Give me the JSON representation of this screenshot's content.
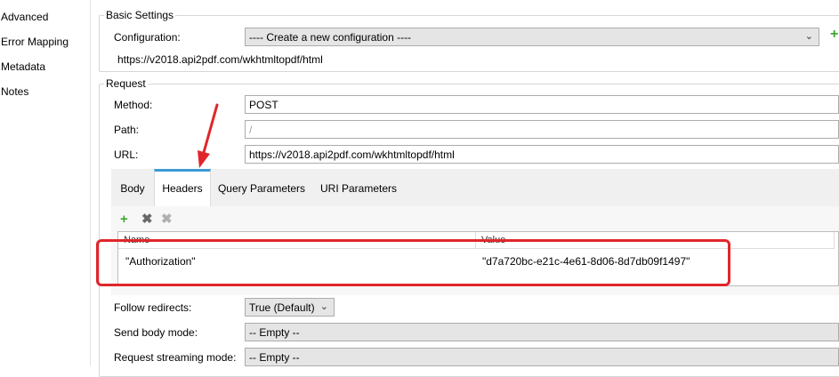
{
  "nav": {
    "items": [
      "Advanced",
      "Error Mapping",
      "Metadata",
      "Notes"
    ]
  },
  "basic_settings": {
    "title": "Basic Settings",
    "configuration_label": "Configuration:",
    "configuration_value": "---- Create a new configuration ----",
    "url_preview": "https://v2018.api2pdf.com/wkhtmltopdf/html"
  },
  "request": {
    "title": "Request",
    "method_label": "Method:",
    "method_value": "POST",
    "path_label": "Path:",
    "path_value": "/",
    "url_label": "URL:",
    "url_value": "https://v2018.api2pdf.com/wkhtmltopdf/html",
    "tabs": [
      "Body",
      "Headers",
      "Query Parameters",
      "URI Parameters"
    ],
    "active_tab": "Headers",
    "headers_table": {
      "columns": [
        "Name",
        "Value"
      ],
      "rows": [
        {
          "name": "\"Authorization\"",
          "value": "\"d7a720bc-e21c-4e61-8d06-8d7db09f1497\""
        }
      ]
    },
    "follow_redirects_label": "Follow redirects:",
    "follow_redirects_value": "True (Default)",
    "send_body_mode_label": "Send body mode:",
    "send_body_mode_value": "-- Empty --",
    "request_streaming_mode_label": "Request streaming mode:",
    "request_streaming_mode_value": "-- Empty --"
  },
  "icons": {
    "add": "plus-icon",
    "delete": "x-icon",
    "delete_all": "x-all-icon",
    "annotation_arrow": "red-arrow",
    "accent_color": "#3c9ad9",
    "highlight_color": "#e0262b",
    "add_color": "#3ea52f"
  }
}
